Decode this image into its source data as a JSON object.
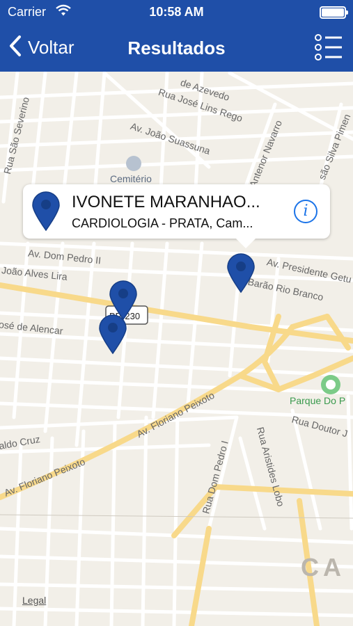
{
  "status_bar": {
    "carrier": "Carrier",
    "time": "10:58 AM"
  },
  "nav": {
    "back_label": "Voltar",
    "title": "Resultados"
  },
  "callout": {
    "title": "IVONETE MARANHAO...",
    "subtitle": "CARDIOLOGIA - PRATA, Cam...",
    "info_icon": "info-icon"
  },
  "map": {
    "legal_label": "Legal",
    "labels": {
      "rua_sao_severino": "Rua São Severino",
      "de_azevedo": "de Azevedo",
      "rua_jose_lins_rego": "Rua José Lins Rego",
      "av_joao_suassuna": "Av. João Suassuna",
      "antenor_navarro": "Antenor Navarro",
      "sao_silva_pimentel": "são Silva Pimen",
      "cemiterio": "Cemitério",
      "av_dom_pedro_ii": "Av. Dom Pedro II",
      "joao_alves_lira": "João Alves Lira",
      "av_presidente_getulio": "Av. Presidente Getu",
      "barao_rio_branco": "Barão Rio Branco",
      "br_230": "BR-230",
      "jose_de_alencar": "osé de Alencar",
      "parque_do": "Parque Do P",
      "rua_doutor": "Rua Doutor J",
      "av_floriano_peixoto_1": "Av. Floriano Peixoto",
      "av_floriano_peixoto_2": "Av. Floriano Peixoto",
      "aldo_cruz": "aldo Cruz",
      "rua_dom_pedro_i": "Rua Dom Pedro I",
      "rua_aristides_lobo": "Rua Aristides Lobo",
      "city_label": "CA"
    },
    "colors": {
      "background": "#f2efe8",
      "street": "#ffffff",
      "arterial": "#f8d98a",
      "pin": "#1f4fa8"
    }
  }
}
